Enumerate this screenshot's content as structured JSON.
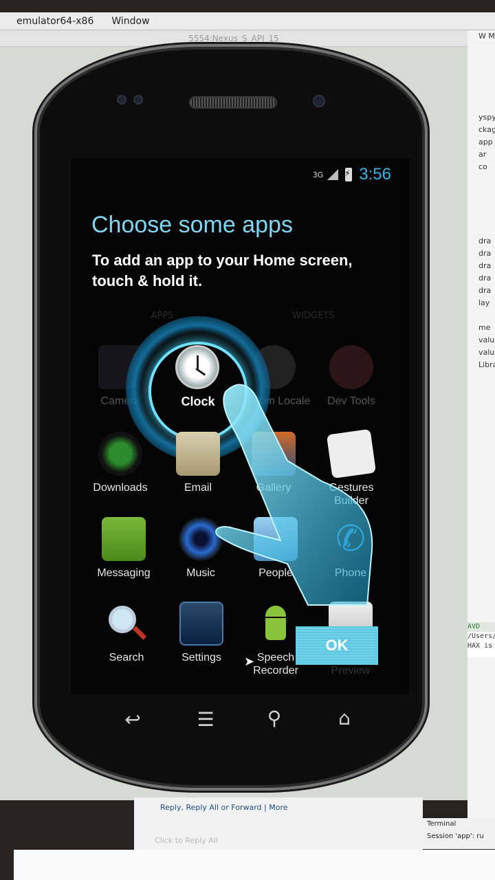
{
  "menubar": {
    "app": "emulator64-x86",
    "menu": "Window"
  },
  "emulator": {
    "title": "5554:Nexus_S_API_15"
  },
  "status_bar": {
    "network": "3G",
    "time": "3:56"
  },
  "cling": {
    "title": "Choose some apps",
    "subtitle": "To add an app to your Home screen, touch & hold it.",
    "ok_label": "OK"
  },
  "tabs": [
    "APPS",
    "WIDGETS"
  ],
  "apps": [
    {
      "label": "Camera",
      "icon": "camera-icon"
    },
    {
      "label": "Clock",
      "icon": "clock-icon"
    },
    {
      "label": "Custom Locale",
      "icon": "gear-icon"
    },
    {
      "label": "Dev Tools",
      "icon": "gear-icon"
    },
    {
      "label": "Downloads",
      "icon": "download-icon"
    },
    {
      "label": "Email",
      "icon": "email-icon"
    },
    {
      "label": "Gallery",
      "icon": "gallery-icon"
    },
    {
      "label": "Gestures Builder",
      "icon": "gestures-icon"
    },
    {
      "label": "Messaging",
      "icon": "messaging-icon"
    },
    {
      "label": "Music",
      "icon": "music-icon"
    },
    {
      "label": "People",
      "icon": "people-icon"
    },
    {
      "label": "Phone",
      "icon": "phone-icon"
    },
    {
      "label": "Search",
      "icon": "search-icon"
    },
    {
      "label": "Settings",
      "icon": "settings-icon"
    },
    {
      "label": "Speech Recorder",
      "icon": "android-icon"
    },
    {
      "label": "Widget Preview",
      "icon": "widget-preview-icon"
    }
  ],
  "ide": {
    "tree": [
      "W Mo",
      "yspy",
      "ckage",
      "app",
      "ar",
      "co",
      "dra",
      "dra",
      "dra",
      "dra",
      "dra",
      "lay",
      "me",
      "valu",
      "valu",
      "Libra"
    ],
    "console": [
      "AVD",
      "/Users/",
      "HAX is"
    ]
  },
  "mail": {
    "links": "Reply, Reply All or Forward | More",
    "reply_hint": "Click to Reply All"
  },
  "terminal": {
    "tab": "Terminal",
    "session": "Session 'app': ru"
  },
  "colors": {
    "accent": "#33b5e5",
    "title": "#7fd6f3",
    "ok": "#5ec6e0"
  }
}
